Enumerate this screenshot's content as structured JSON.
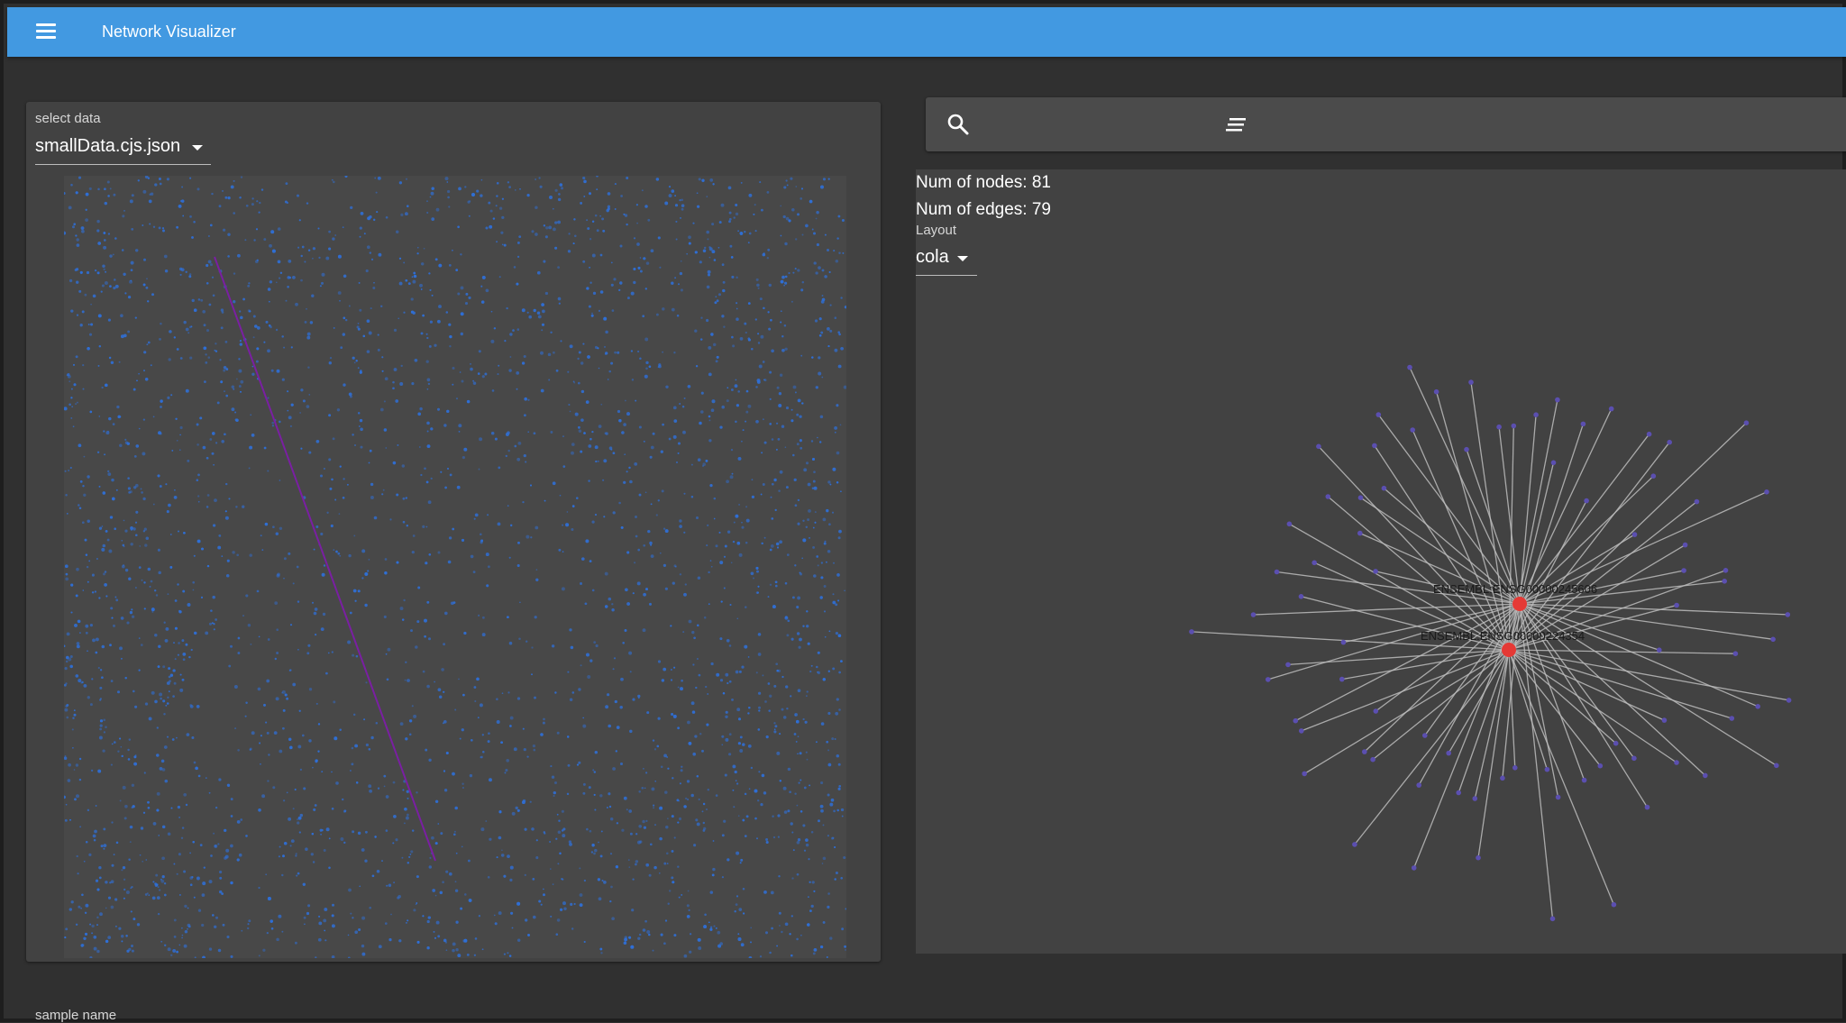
{
  "app": {
    "title": "Network Visualizer"
  },
  "left_panel": {
    "select_label": "select data",
    "selected_file": "smallData.cjs.json"
  },
  "search": {
    "placeholder": ""
  },
  "graph_panel": {
    "num_nodes": "Num of nodes: 81",
    "num_edges": "Num of edges: 79",
    "layout_label": "Layout",
    "layout_value": "cola",
    "hub_labels": [
      "ENSEMBL:ENSG00000245606",
      "ENSEMBL:ENSG00000224354"
    ]
  },
  "footer": {
    "sample_name_label": "sample name"
  },
  "colors": {
    "appbar": "#4299e1",
    "panel": "#424242",
    "scatter_point": "#2f6fd6",
    "highlight_edge": "#7a1fa2",
    "hub_node": "#e53935",
    "leaf_node": "#5b4fb0",
    "edge": "#bdbdbd"
  },
  "icons": {
    "menu": "menu-icon",
    "search": "search-icon",
    "sort": "sort-icon"
  }
}
